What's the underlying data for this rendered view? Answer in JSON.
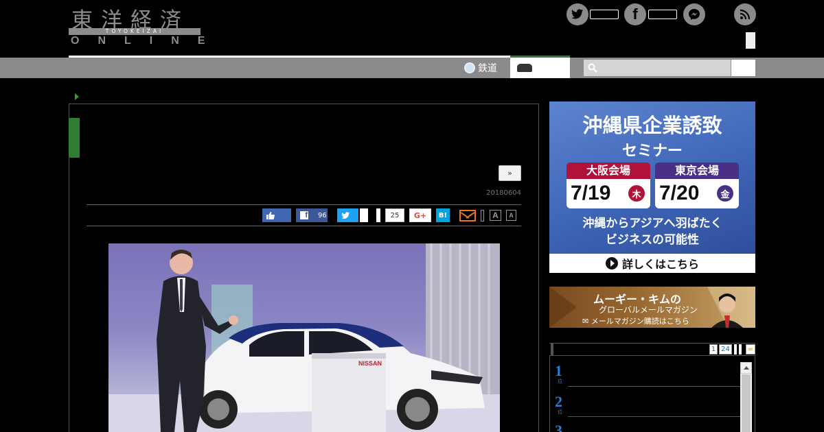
{
  "header": {
    "logo_kanji": "東洋経済",
    "logo_romaji": "TOYOKEIZAI",
    "logo_online": "ONLINE"
  },
  "nav": {
    "rail_label": "鉄道",
    "rail_icon": "train-icon",
    "car_icon": "car-icon"
  },
  "search": {
    "icon": "search-icon"
  },
  "article": {
    "more_label": "»",
    "date": "20180604",
    "share": {
      "fb_share_count": "96",
      "pocket_count": "25",
      "gplus_label": "G+",
      "hatena_label": "B!",
      "font_large": "A",
      "font_small": "A"
    }
  },
  "sidebar": {
    "ad1": {
      "title": "沖縄県企業誘致",
      "subtitle": "セミナー",
      "venue1_name": "大阪会場",
      "venue1_date": "7/19",
      "venue1_day": "木",
      "venue2_name": "東京会場",
      "venue2_date": "7/20",
      "venue2_day": "金",
      "desc_line1": "沖縄からアジアへ羽ばたく",
      "desc_line2": "ビジネスの可能性",
      "cta": "詳しくはこちら",
      "colors": {
        "venue1": "#b0123a",
        "venue2": "#4a2f86"
      }
    },
    "ad2": {
      "title": "ムーギー・キムの",
      "subtitle": "グローバルメールマガジン",
      "cta": "メールマガジン購読はこちら"
    },
    "ranking": {
      "pages": [
        "1",
        "24"
      ],
      "more_label": "=",
      "items": [
        {
          "rank": "1",
          "unit": "位"
        },
        {
          "rank": "2",
          "unit": "位"
        },
        {
          "rank": "3",
          "unit": "位"
        }
      ]
    }
  },
  "colors": {
    "accent_green": "#2e7d32",
    "nav_gray": "#8a8a8a",
    "facebook": "#3b5998",
    "twitter": "#1da1f2",
    "hatena": "#00a4de",
    "mail_orange": "#e87722"
  }
}
